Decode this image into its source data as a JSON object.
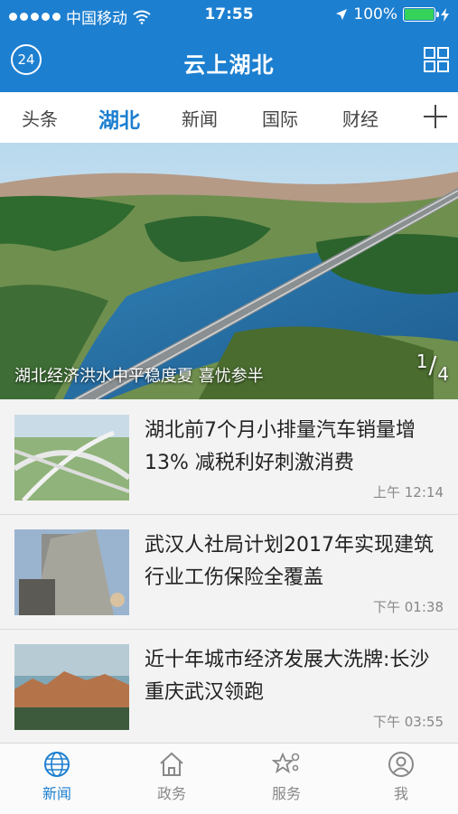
{
  "status_bar": {
    "carrier": "中国移动",
    "time": "17:55",
    "battery": "100%"
  },
  "nav_bar": {
    "badge": "24",
    "title": "云上湖北"
  },
  "channel_tabs": [
    "头条",
    "湖北",
    "新闻",
    "国际",
    "财经"
  ],
  "active_tab": "湖北",
  "hero": {
    "caption": "湖北经济洪水中平稳度夏 喜忧参半",
    "index_current": "1",
    "index_total": "4"
  },
  "news": [
    {
      "headline": "湖北前7个月小排量汽车销量增13% 减税利好刺激消费",
      "time": "上午 12:14"
    },
    {
      "headline": "武汉人社局计划2017年实现建筑行业工伤保险全覆盖",
      "time": "下午 01:38"
    },
    {
      "headline": "近十年城市经济发展大洗牌:长沙重庆武汉领跑",
      "time": "下午 03:55"
    }
  ],
  "bottom_tabs": [
    {
      "label": "新闻",
      "icon": "globe-icon"
    },
    {
      "label": "政务",
      "icon": "home-icon"
    },
    {
      "label": "服务",
      "icon": "star-services-icon"
    },
    {
      "label": "我",
      "icon": "person-icon"
    }
  ],
  "colors": {
    "brand_blue": "#1d7fd0",
    "battery_green": "#36d35b",
    "inactive_gray": "#888888"
  }
}
